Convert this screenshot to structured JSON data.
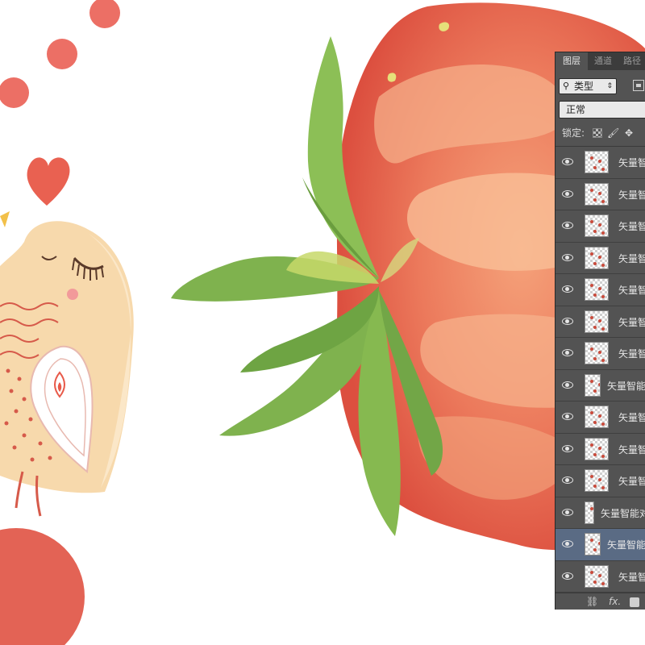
{
  "panel": {
    "tabs": [
      "图层",
      "通道",
      "路径"
    ],
    "filter": {
      "search_icon": "search-icon",
      "label": "类型",
      "arrow": "⇕"
    },
    "blend_mode": "正常",
    "lock_label": "锁定:",
    "layers": [
      {
        "name": "矢量智",
        "selected": false
      },
      {
        "name": "矢量智",
        "selected": false
      },
      {
        "name": "矢量智",
        "selected": false
      },
      {
        "name": "矢量智",
        "selected": false
      },
      {
        "name": "矢量智",
        "selected": false
      },
      {
        "name": "矢量智",
        "selected": false
      },
      {
        "name": "矢量智",
        "selected": false
      },
      {
        "name": "矢量智能",
        "selected": false
      },
      {
        "name": "矢量智",
        "selected": false
      },
      {
        "name": "矢量智",
        "selected": false
      },
      {
        "name": "矢量智",
        "selected": false
      },
      {
        "name": "矢量智能对",
        "selected": false
      },
      {
        "name": "矢量智能",
        "selected": true
      },
      {
        "name": "矢量智",
        "selected": false
      }
    ],
    "bottom_icons": [
      "link-icon",
      "fx-icon",
      "mask-icon"
    ],
    "fx_label": "fx."
  },
  "colors": {
    "panel_bg": "#535353",
    "selected_layer": "#5a6b84",
    "strawberry": "#e8654f",
    "leaf": "#7fb24e",
    "dots": "#ec6f65"
  }
}
